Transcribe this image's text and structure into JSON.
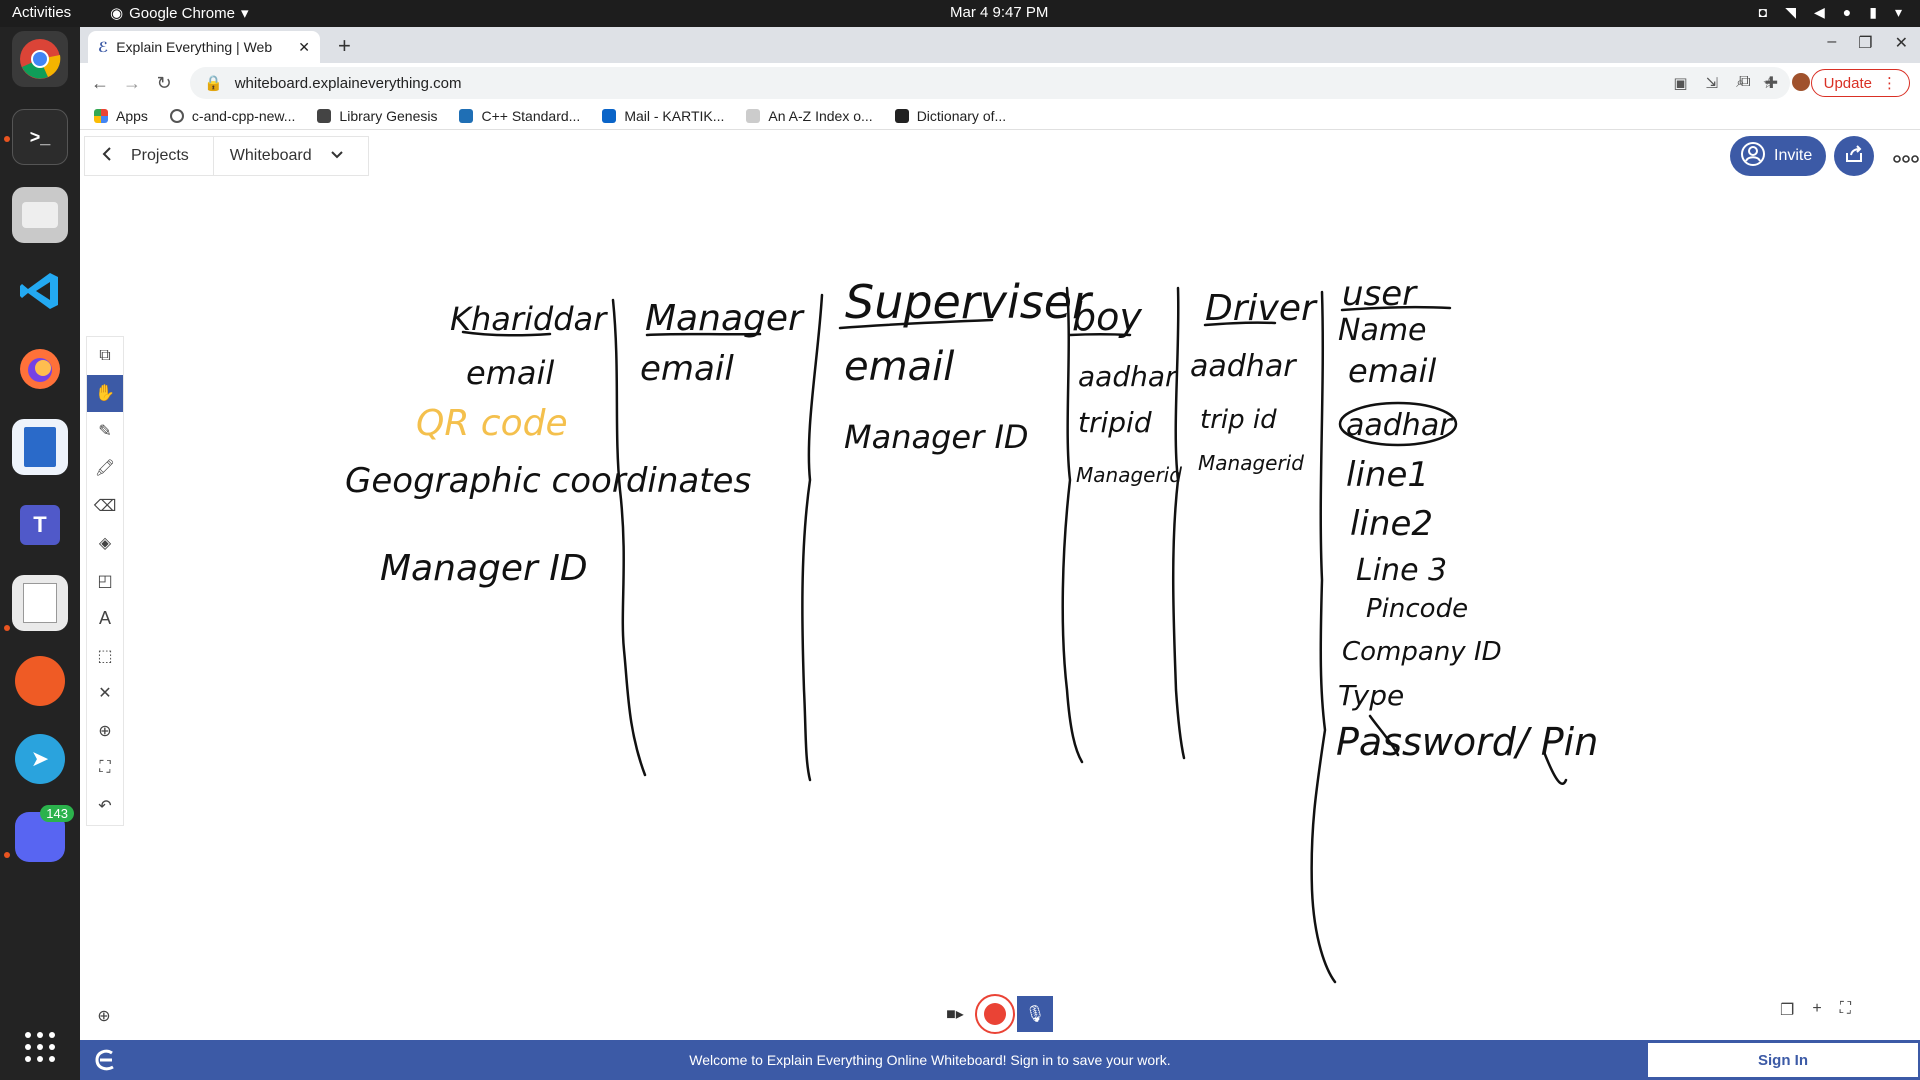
{
  "system": {
    "activities": "Activities",
    "app_name": "Google Chrome",
    "clock": "Mar 4  9:47 PM",
    "dock_badge": "143"
  },
  "browser": {
    "tab_title": "Explain Everything | Web",
    "url": "whiteboard.explaineverything.com",
    "update_label": "Update",
    "bookmarks": [
      "Apps",
      "c-and-cpp-new...",
      "Library Genesis",
      "C++ Standard...",
      "Mail - KARTIK...",
      "An A-Z Index o...",
      "Dictionary of..."
    ]
  },
  "app": {
    "breadcrumb_projects": "Projects",
    "board_name": "Whiteboard",
    "invite_label": "Invite",
    "footer_message": "Welcome to Explain Everything Online Whiteboard! Sign in to save your work.",
    "sign_in_label": "Sign In"
  },
  "whiteboard": {
    "columns": [
      {
        "header": "Khariddar",
        "fields": [
          "email",
          "QR code",
          "Geographic coordinates",
          "Manager ID"
        ]
      },
      {
        "header": "Manager",
        "fields": [
          "email"
        ]
      },
      {
        "header": "Superviser",
        "fields": [
          "email",
          "Manager ID"
        ]
      },
      {
        "header": "boy",
        "fields": [
          "aadhar",
          "tripid",
          "Managerid"
        ]
      },
      {
        "header": "Driver",
        "fields": [
          "aadhar",
          "trip id",
          "Managerid"
        ]
      },
      {
        "header": "user",
        "fields": [
          "Name",
          "email",
          "aadhar",
          "line1",
          "line2",
          "Line 3",
          "Pincode",
          "Company ID",
          "Type",
          "Password/ Pin"
        ]
      }
    ],
    "highlight_color": "#f4c04d"
  }
}
